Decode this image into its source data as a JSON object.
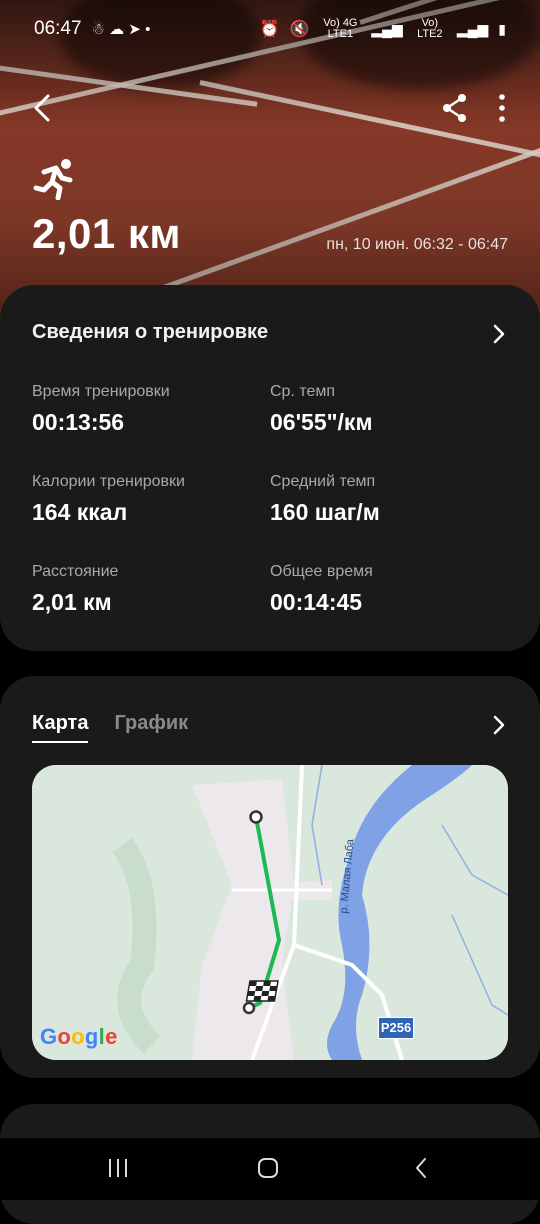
{
  "status_bar": {
    "time": "06:47",
    "sim1": "Vo) 4G LTE1",
    "sim2": "Vo) LTE2"
  },
  "header": {
    "distance": "2,01 км",
    "date_range": "пн, 10 июн. 06:32 - 06:47"
  },
  "workout_details": {
    "title": "Сведения о тренировке",
    "stats": [
      {
        "label": "Время тренировки",
        "value": "00:13:56"
      },
      {
        "label": "Ср. темп",
        "value": "06'55\"/км"
      },
      {
        "label": "Калории тренировки",
        "value": "164 ккал"
      },
      {
        "label": "Средний темп",
        "value": "160 шаг/м"
      },
      {
        "label": "Расстояние",
        "value": "2,01 км"
      },
      {
        "label": "Общее время",
        "value": "00:14:45"
      }
    ]
  },
  "map_section": {
    "tabs": [
      "Карта",
      "График"
    ],
    "active_tab": "Карта",
    "river_label": "р. Малая Лаба",
    "road_label": "Р256",
    "attribution": "Google",
    "route_color": "#1db954"
  },
  "colors": {
    "card_bg": "#1a1a1a",
    "secondary_text": "#a9a9a9"
  }
}
